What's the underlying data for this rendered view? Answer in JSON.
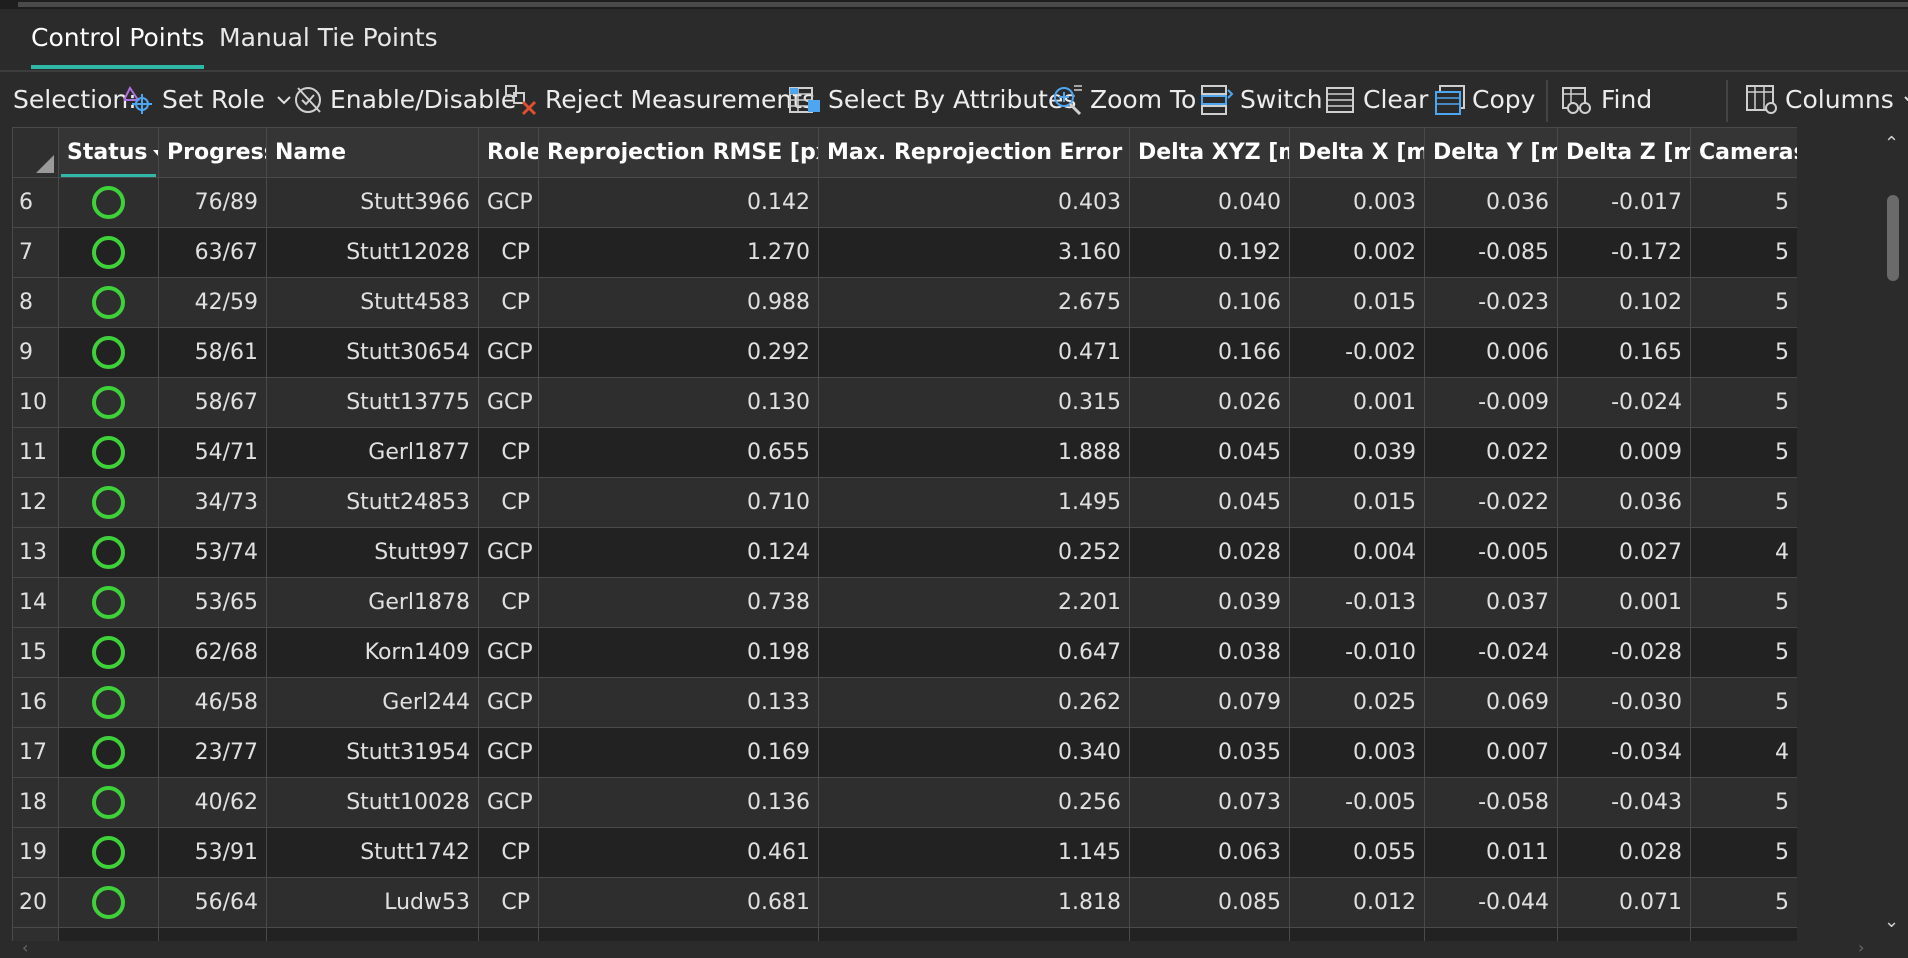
{
  "tabs": [
    {
      "label": "Control Points",
      "active": true
    },
    {
      "label": "Manual Tie Points",
      "active": false
    }
  ],
  "toolbar": {
    "selection_label": "Selection:",
    "set_role": "Set Role",
    "enable_disable": "Enable/Disable",
    "reject_measurements": "Reject Measurements",
    "select_by_attributes": "Select By Attributes",
    "zoom_to": "Zoom To",
    "switch": "Switch",
    "clear": "Clear",
    "copy": "Copy",
    "find": "Find",
    "columns": "Columns"
  },
  "colors": {
    "accent": "#2fb8a8",
    "status_ok": "#3fd13a",
    "background": "#2b2b2b"
  },
  "table": {
    "columns": [
      "Status",
      "Progress",
      "Name",
      "Role",
      "Reprojection RMSE [px]",
      "Max. Reprojection Error [px]",
      "Delta XYZ [m]",
      "Delta X [m]",
      "Delta Y [m]",
      "Delta Z [m]",
      "Cameras"
    ],
    "sorted_column": "Status",
    "rows": [
      {
        "num": "6",
        "progress": "76/89",
        "name": "Stutt3966",
        "role": "GCP",
        "rmse": "0.142",
        "max_err": "0.403",
        "dxyz": "0.040",
        "dx": "0.003",
        "dy": "0.036",
        "dz": "-0.017",
        "cameras": "5"
      },
      {
        "num": "7",
        "progress": "63/67",
        "name": "Stutt12028",
        "role": "CP",
        "rmse": "1.270",
        "max_err": "3.160",
        "dxyz": "0.192",
        "dx": "0.002",
        "dy": "-0.085",
        "dz": "-0.172",
        "cameras": "5"
      },
      {
        "num": "8",
        "progress": "42/59",
        "name": "Stutt4583",
        "role": "CP",
        "rmse": "0.988",
        "max_err": "2.675",
        "dxyz": "0.106",
        "dx": "0.015",
        "dy": "-0.023",
        "dz": "0.102",
        "cameras": "5"
      },
      {
        "num": "9",
        "progress": "58/61",
        "name": "Stutt30654",
        "role": "GCP",
        "rmse": "0.292",
        "max_err": "0.471",
        "dxyz": "0.166",
        "dx": "-0.002",
        "dy": "0.006",
        "dz": "0.165",
        "cameras": "5"
      },
      {
        "num": "10",
        "progress": "58/67",
        "name": "Stutt13775",
        "role": "GCP",
        "rmse": "0.130",
        "max_err": "0.315",
        "dxyz": "0.026",
        "dx": "0.001",
        "dy": "-0.009",
        "dz": "-0.024",
        "cameras": "5"
      },
      {
        "num": "11",
        "progress": "54/71",
        "name": "Gerl1877",
        "role": "CP",
        "rmse": "0.655",
        "max_err": "1.888",
        "dxyz": "0.045",
        "dx": "0.039",
        "dy": "0.022",
        "dz": "0.009",
        "cameras": "5"
      },
      {
        "num": "12",
        "progress": "34/73",
        "name": "Stutt24853",
        "role": "CP",
        "rmse": "0.710",
        "max_err": "1.495",
        "dxyz": "0.045",
        "dx": "0.015",
        "dy": "-0.022",
        "dz": "0.036",
        "cameras": "5"
      },
      {
        "num": "13",
        "progress": "53/74",
        "name": "Stutt997",
        "role": "GCP",
        "rmse": "0.124",
        "max_err": "0.252",
        "dxyz": "0.028",
        "dx": "0.004",
        "dy": "-0.005",
        "dz": "0.027",
        "cameras": "4"
      },
      {
        "num": "14",
        "progress": "53/65",
        "name": "Gerl1878",
        "role": "CP",
        "rmse": "0.738",
        "max_err": "2.201",
        "dxyz": "0.039",
        "dx": "-0.013",
        "dy": "0.037",
        "dz": "0.001",
        "cameras": "5"
      },
      {
        "num": "15",
        "progress": "62/68",
        "name": "Korn1409",
        "role": "GCP",
        "rmse": "0.198",
        "max_err": "0.647",
        "dxyz": "0.038",
        "dx": "-0.010",
        "dy": "-0.024",
        "dz": "-0.028",
        "cameras": "5"
      },
      {
        "num": "16",
        "progress": "46/58",
        "name": "Gerl244",
        "role": "GCP",
        "rmse": "0.133",
        "max_err": "0.262",
        "dxyz": "0.079",
        "dx": "0.025",
        "dy": "0.069",
        "dz": "-0.030",
        "cameras": "5"
      },
      {
        "num": "17",
        "progress": "23/77",
        "name": "Stutt31954",
        "role": "GCP",
        "rmse": "0.169",
        "max_err": "0.340",
        "dxyz": "0.035",
        "dx": "0.003",
        "dy": "0.007",
        "dz": "-0.034",
        "cameras": "4"
      },
      {
        "num": "18",
        "progress": "40/62",
        "name": "Stutt10028",
        "role": "GCP",
        "rmse": "0.136",
        "max_err": "0.256",
        "dxyz": "0.073",
        "dx": "-0.005",
        "dy": "-0.058",
        "dz": "-0.043",
        "cameras": "5"
      },
      {
        "num": "19",
        "progress": "53/91",
        "name": "Stutt1742",
        "role": "CP",
        "rmse": "0.461",
        "max_err": "1.145",
        "dxyz": "0.063",
        "dx": "0.055",
        "dy": "0.011",
        "dz": "0.028",
        "cameras": "5"
      },
      {
        "num": "20",
        "progress": "56/64",
        "name": "Ludw53",
        "role": "CP",
        "rmse": "0.681",
        "max_err": "1.818",
        "dxyz": "0.085",
        "dx": "0.012",
        "dy": "-0.044",
        "dz": "0.071",
        "cameras": "5"
      }
    ]
  }
}
